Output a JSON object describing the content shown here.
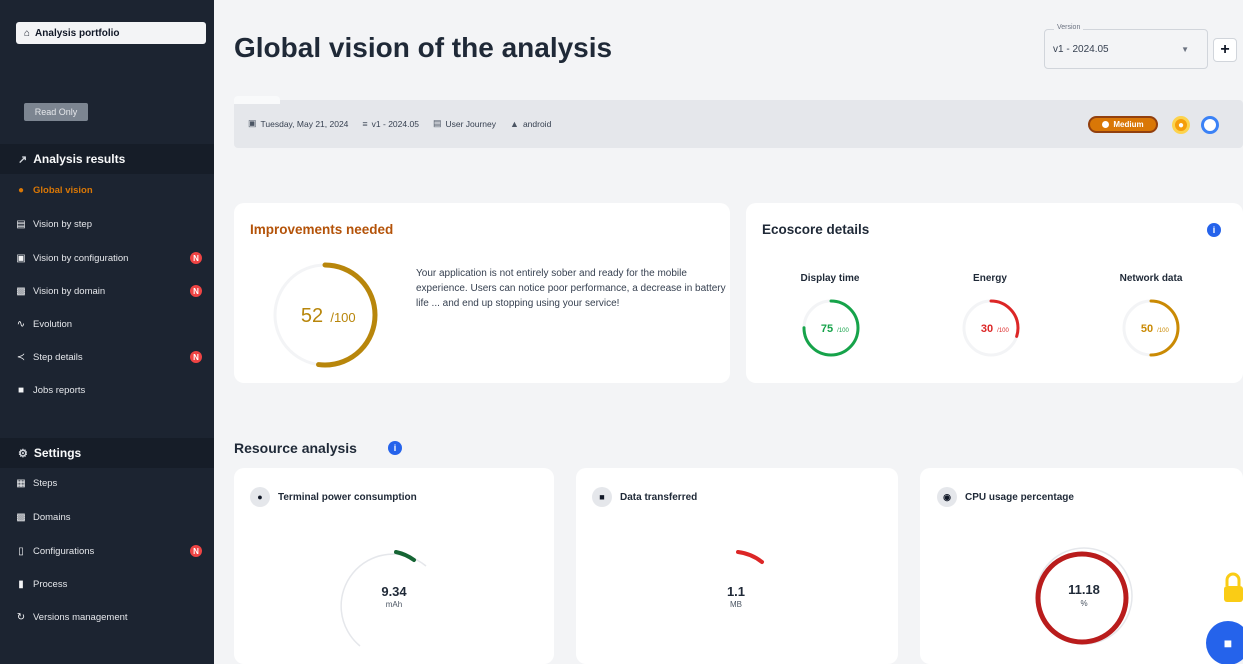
{
  "sidebar": {
    "portfolio_label": "Analysis portfolio",
    "readonly_label": "Read Only",
    "analysis_section": "Analysis results",
    "analysis_items": [
      {
        "label": "Global vision",
        "badge": ""
      },
      {
        "label": "Vision by step",
        "badge": ""
      },
      {
        "label": "Vision by configuration",
        "badge": "N"
      },
      {
        "label": "Vision by domain",
        "badge": "N"
      },
      {
        "label": "Evolution",
        "badge": ""
      },
      {
        "label": "Step details",
        "badge": "N"
      },
      {
        "label": "Jobs reports",
        "badge": ""
      }
    ],
    "settings_section": "Settings",
    "settings_items": [
      {
        "label": "Steps",
        "badge": ""
      },
      {
        "label": "Domains",
        "badge": ""
      },
      {
        "label": "Configurations",
        "badge": "N"
      },
      {
        "label": "Process",
        "badge": ""
      },
      {
        "label": "Versions management",
        "badge": ""
      }
    ]
  },
  "header": {
    "title": "Global vision of the analysis",
    "version_label": "Version",
    "version_value": "v1 - 2024.05",
    "add_label": "+"
  },
  "infobar": {
    "date": "Tuesday, May 21, 2024",
    "version": "v1 - 2024.05",
    "journey": "User Journey",
    "platform": "android",
    "level": "Medium"
  },
  "improvements": {
    "title": "Improvements needed",
    "score": "52",
    "score_max": "/100",
    "score_fraction": 0.52,
    "text": "Your application is not entirely sober and ready for the mobile experience. Users can notice poor performance, a decrease in battery life ... and end up stopping using your service!"
  },
  "ecoscore": {
    "title": "Ecoscore details",
    "info": "i",
    "gauges": [
      {
        "label": "Display time",
        "value": "75",
        "max": "/100",
        "fraction": 0.75,
        "color": "#16a34a"
      },
      {
        "label": "Energy",
        "value": "30",
        "max": "/100",
        "fraction": 0.3,
        "color": "#dc2626"
      },
      {
        "label": "Network data",
        "value": "50",
        "max": "/100",
        "fraction": 0.5,
        "color": "#ca8a04"
      }
    ]
  },
  "resources": {
    "title": "Resource analysis",
    "info": "i",
    "cards": [
      {
        "label": "Terminal power consumption",
        "value": "9.34",
        "unit": "mAh",
        "color": "#166534"
      },
      {
        "label": "Data transferred",
        "value": "1.1",
        "unit": "MB",
        "color": "#dc2626"
      },
      {
        "label": "CPU usage percentage",
        "value": "11.18",
        "unit": "%",
        "color": "#b91c1c"
      }
    ]
  },
  "colors": {
    "sidebar_bg": "#1c2431",
    "accent": "#d97706",
    "primary": "#2563eb",
    "badge_red": "#ef4444"
  },
  "icons": {
    "portfolio": "home-icon",
    "chat": "chat-icon",
    "lock": "lock-icon"
  }
}
